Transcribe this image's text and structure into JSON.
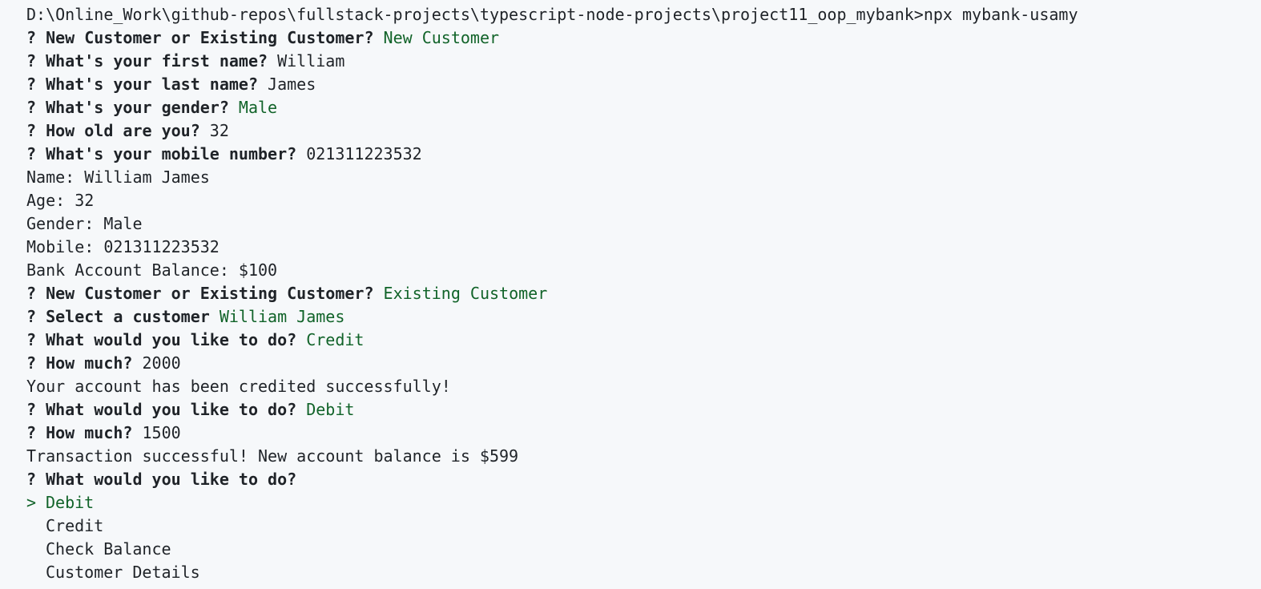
{
  "terminal": {
    "cwd": "D:\\Online_Work\\github-repos\\fullstack-projects\\typescript-node-projects\\project11_oop_mybank>",
    "command": "npx mybank-usamy"
  },
  "colors": {
    "background": "#f6f8fa",
    "text": "#1f2328",
    "answer_green": "#116329"
  },
  "prompts": [
    {
      "q": "?",
      "text": "New Customer or Existing Customer?",
      "answer": "New Customer",
      "highlight": true
    },
    {
      "q": "?",
      "text": "What's your first name?",
      "answer": "William",
      "highlight": false
    },
    {
      "q": "?",
      "text": "What's your last name?",
      "answer": "James",
      "highlight": false
    },
    {
      "q": "?",
      "text": "What's your gender?",
      "answer": "Male",
      "highlight": true
    },
    {
      "q": "?",
      "text": "How old are you?",
      "answer": "32",
      "highlight": false
    },
    {
      "q": "?",
      "text": "What's your mobile number?",
      "answer": "021311223532",
      "highlight": false
    }
  ],
  "details": [
    "Name: William James",
    "Age: 32",
    "Gender: Male",
    "Mobile: 021311223532",
    "Bank Account Balance: $100"
  ],
  "prompts2": [
    {
      "q": "?",
      "text": "New Customer or Existing Customer?",
      "answer": "Existing Customer",
      "highlight": true
    },
    {
      "q": "?",
      "text": "Select a customer",
      "answer": "William James",
      "highlight": true
    },
    {
      "q": "?",
      "text": "What would you like to do?",
      "answer": "Credit",
      "highlight": true
    },
    {
      "q": "?",
      "text": "How much?",
      "answer": "2000",
      "highlight": false
    }
  ],
  "msg_credit": "Your account has been credited successfully!",
  "prompts3": [
    {
      "q": "?",
      "text": "What would you like to do?",
      "answer": "Debit",
      "highlight": true
    },
    {
      "q": "?",
      "text": "How much?",
      "answer": "1500",
      "highlight": false
    }
  ],
  "msg_debit": "Transaction successful! New account balance is $599",
  "final_prompt": {
    "q": "?",
    "text": "What would you like to do?"
  },
  "menu": {
    "pointer": ">",
    "options": [
      "Debit",
      "Credit",
      "Check Balance",
      "Customer Details"
    ],
    "selected_index": 0
  }
}
